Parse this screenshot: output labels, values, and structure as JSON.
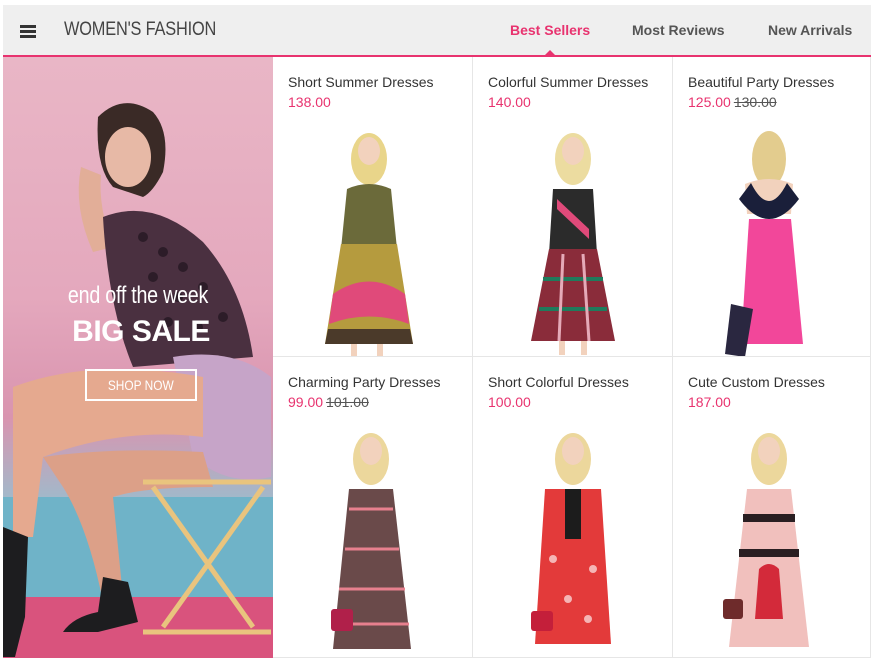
{
  "header": {
    "brand": "WOMEN'S FASHION",
    "tabs": [
      {
        "label": "Best Sellers",
        "active": true
      },
      {
        "label": "Most Reviews",
        "active": false
      },
      {
        "label": "New Arrivals",
        "active": false
      }
    ]
  },
  "banner": {
    "line1": "end off the week",
    "line2": "BIG SALE",
    "button": "SHOP NOW"
  },
  "products": [
    {
      "name": "Short Summer Dresses",
      "price": "138.00",
      "old_price": ""
    },
    {
      "name": "Colorful Summer Dresses",
      "price": "140.00",
      "old_price": ""
    },
    {
      "name": "Beautiful Party Dresses",
      "price": "125.00",
      "old_price": "130.00"
    },
    {
      "name": "Charming Party Dresses",
      "price": "99.00",
      "old_price": "101.00"
    },
    {
      "name": "Short Colorful Dresses",
      "price": "100.00",
      "old_price": ""
    },
    {
      "name": "Cute Custom Dresses",
      "price": "187.00",
      "old_price": ""
    }
  ],
  "colors": {
    "accent": "#e8336f",
    "header_bg": "#efefef"
  },
  "icons": {
    "menu": "hamburger-menu-icon"
  }
}
